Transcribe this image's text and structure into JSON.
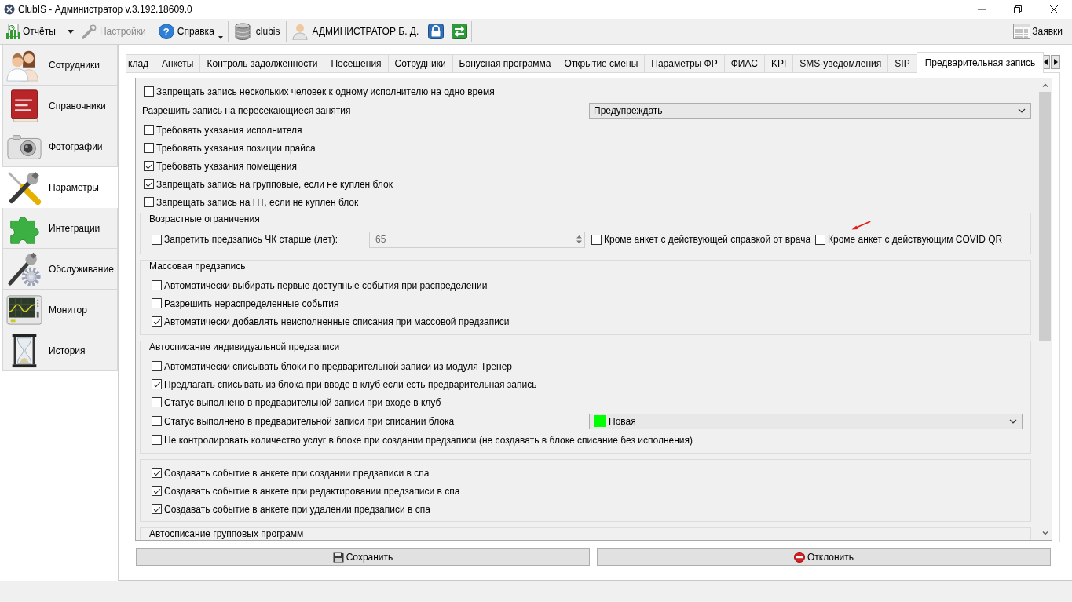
{
  "window": {
    "title": "ClubIS - Администратор v.3.192.18609.0"
  },
  "toolbar": {
    "reports": {
      "label": "Отчёты"
    },
    "settings": {
      "label": "Настройки",
      "disabled": true
    },
    "help": {
      "label": "Справка",
      "icon": "?"
    },
    "database": {
      "label": "clubis"
    },
    "user": {
      "label": "АДМИНИСТРАТОР Б. Д."
    },
    "requests": {
      "label": "Заявки"
    }
  },
  "sidebar": {
    "items": [
      {
        "label": "Сотрудники",
        "selected": false
      },
      {
        "label": "Справочники",
        "selected": false
      },
      {
        "label": "Фотографии",
        "selected": false
      },
      {
        "label": "Параметры",
        "selected": true
      },
      {
        "label": "Интеграции",
        "selected": false
      },
      {
        "label": "Обслуживание",
        "selected": false
      },
      {
        "label": "Монитор",
        "selected": false
      },
      {
        "label": "История",
        "selected": false
      }
    ]
  },
  "tabs": [
    {
      "label": "клад",
      "selected": false
    },
    {
      "label": "Анкеты",
      "selected": false
    },
    {
      "label": "Контроль задолженности",
      "selected": false
    },
    {
      "label": "Посещения",
      "selected": false
    },
    {
      "label": "Сотрудники",
      "selected": false
    },
    {
      "label": "Бонусная программа",
      "selected": false
    },
    {
      "label": "Открытие смены",
      "selected": false
    },
    {
      "label": "Параметры ФР",
      "selected": false
    },
    {
      "label": "ФИАС",
      "selected": false
    },
    {
      "label": "KPI",
      "selected": false
    },
    {
      "label": "SMS-уведомления",
      "selected": false
    },
    {
      "label": "SIP",
      "selected": false
    },
    {
      "label": "Предварительная запись",
      "selected": true
    }
  ],
  "form": {
    "rows": [
      {
        "kind": "checkbox",
        "label": "Запрещать запись нескольких человек к одному исполнителю на одно время",
        "checked": false
      },
      {
        "kind": "select",
        "label": "Разрешить запись на пересекающиеся занятия",
        "value": "Предупреждать"
      },
      {
        "kind": "checkbox",
        "label": "Требовать указания исполнителя",
        "checked": false
      },
      {
        "kind": "checkbox",
        "label": "Требовать указания позиции прайса",
        "checked": false
      },
      {
        "kind": "checkbox",
        "label": "Требовать указания помещения",
        "checked": true
      },
      {
        "kind": "checkbox",
        "label": "Запрещать запись на групповые, если не куплен блок",
        "checked": true
      },
      {
        "kind": "checkbox",
        "label": "Запрещать запись на ПТ, если не куплен блок",
        "checked": false
      },
      {
        "kind": "group",
        "title": "Возрастные ограничения",
        "rows": [
          {
            "kind": "age-limit",
            "label": "Запретить предзапись ЧК старше (лет):",
            "checked": false,
            "spinner": {
              "value": "65",
              "disabled": true
            },
            "options": [
              {
                "label": "Кроме анкет с действующей справкой от врача",
                "checked": false
              },
              {
                "label": "Кроме анкет с действующим COVID QR",
                "checked": false
              }
            ]
          }
        ]
      },
      {
        "kind": "group",
        "title": "Массовая предзапись",
        "rows": [
          {
            "kind": "checkbox",
            "label": "Автоматически выбирать первые доступные события при распределении",
            "checked": false
          },
          {
            "kind": "checkbox",
            "label": "Разрешить нераспределенные события",
            "checked": false
          },
          {
            "kind": "checkbox",
            "label": "Автоматически добавлять неисполненные списания при массовой предзаписи",
            "checked": true
          }
        ]
      },
      {
        "kind": "group",
        "title": "Автосписание индивидуальной предзаписи",
        "rows": [
          {
            "kind": "checkbox",
            "label": "Автоматически списывать блоки по предварительной записи из модуля Тренер",
            "checked": false
          },
          {
            "kind": "checkbox",
            "label": "Предлагать списывать из блока при вводе в клуб если есть предварительная запись",
            "checked": true
          },
          {
            "kind": "checkbox",
            "label": "Статус выполнено в предварительной записи при входе в клуб",
            "checked": false
          },
          {
            "kind": "checkbox-select",
            "label": "Статус выполнено в предварительной записи при списании блока",
            "checked": false,
            "value": "Новая",
            "color": "#00ff00"
          },
          {
            "kind": "checkbox",
            "label": "Не контролировать количество услуг в блоке при создании предзаписи (не создавать в блоке списание без исполнения)",
            "checked": false
          }
        ]
      },
      {
        "kind": "group",
        "rows": [
          {
            "kind": "checkbox",
            "label": "Создавать событие в анкете при создании предзаписи в спа",
            "checked": true
          },
          {
            "kind": "checkbox",
            "label": "Создавать событие в анкете при редактировании предзаписи в спа",
            "checked": true
          },
          {
            "kind": "checkbox",
            "label": "Создавать событие в анкете при удалении предзаписи в спа",
            "checked": true
          }
        ]
      },
      {
        "kind": "group",
        "title": "Автосписание групповых программ"
      }
    ]
  },
  "buttons": [
    {
      "label": "Сохранить"
    },
    {
      "label": "Отклонить"
    }
  ]
}
